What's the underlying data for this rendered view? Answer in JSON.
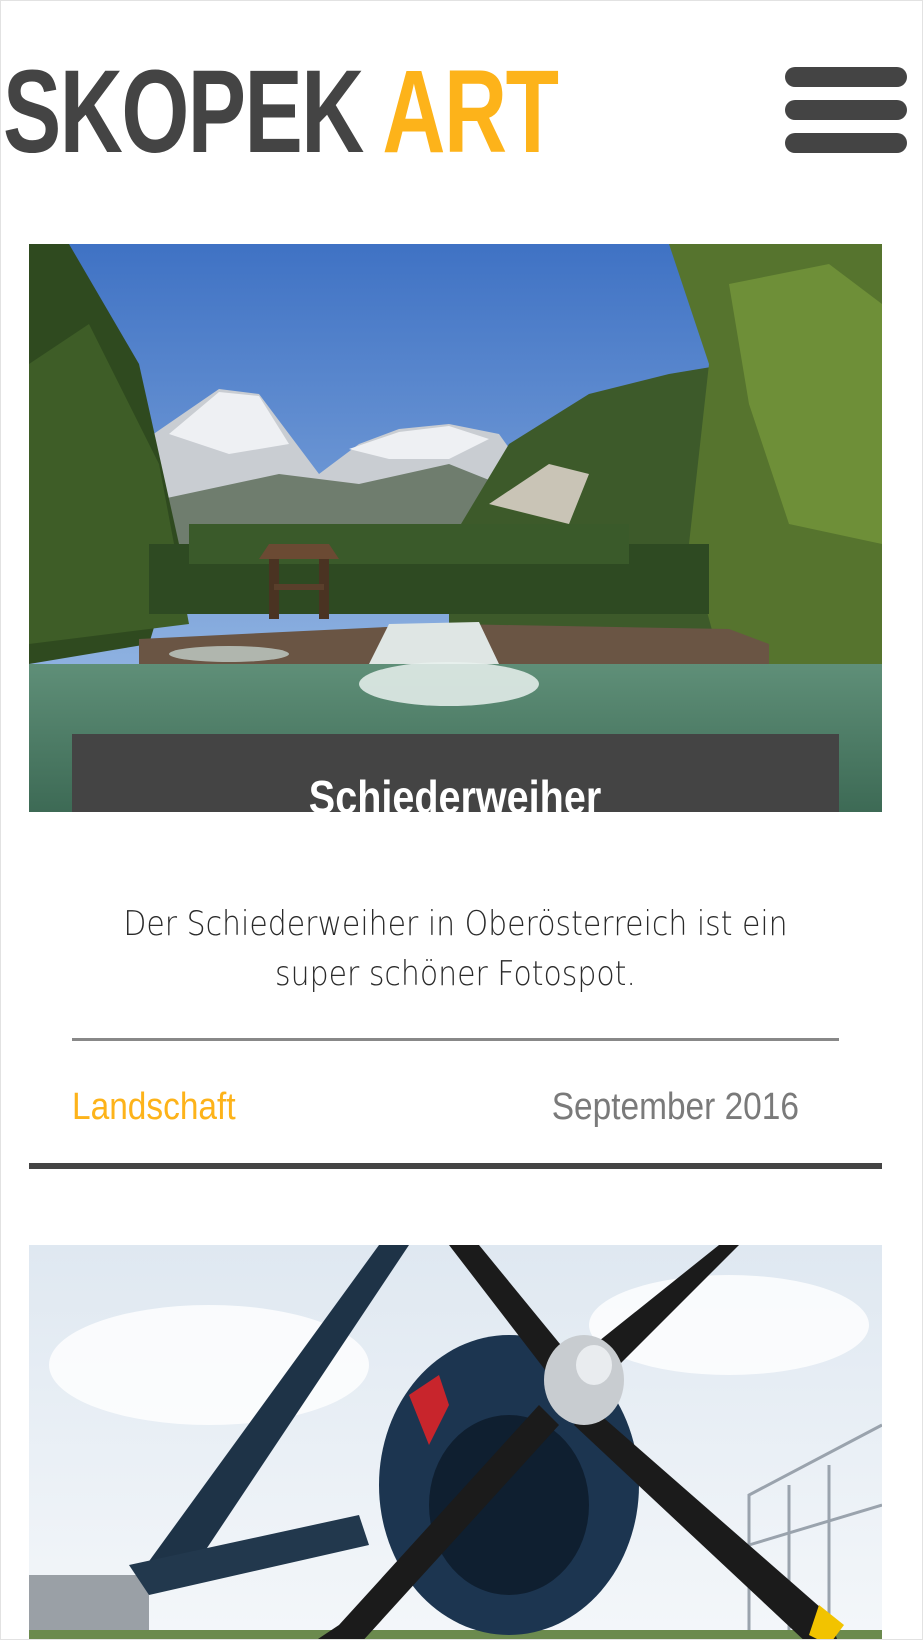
{
  "header": {
    "logo_dark": "SKOPEK",
    "logo_accent": "ART",
    "menu_icon": "hamburger-menu-icon"
  },
  "posts": [
    {
      "title": "Schiederweiher",
      "excerpt": "Der Schiederweiher in Oberösterreich ist ein super schöner Fotospot.",
      "category": "Landschaft",
      "date": "September 2016",
      "image": "mountain-lake-photo"
    },
    {
      "image": "vintage-propeller-plane-photo"
    }
  ],
  "colors": {
    "accent": "#fdb31a",
    "dark": "#444444",
    "meta_gray": "#7a7a7a"
  }
}
